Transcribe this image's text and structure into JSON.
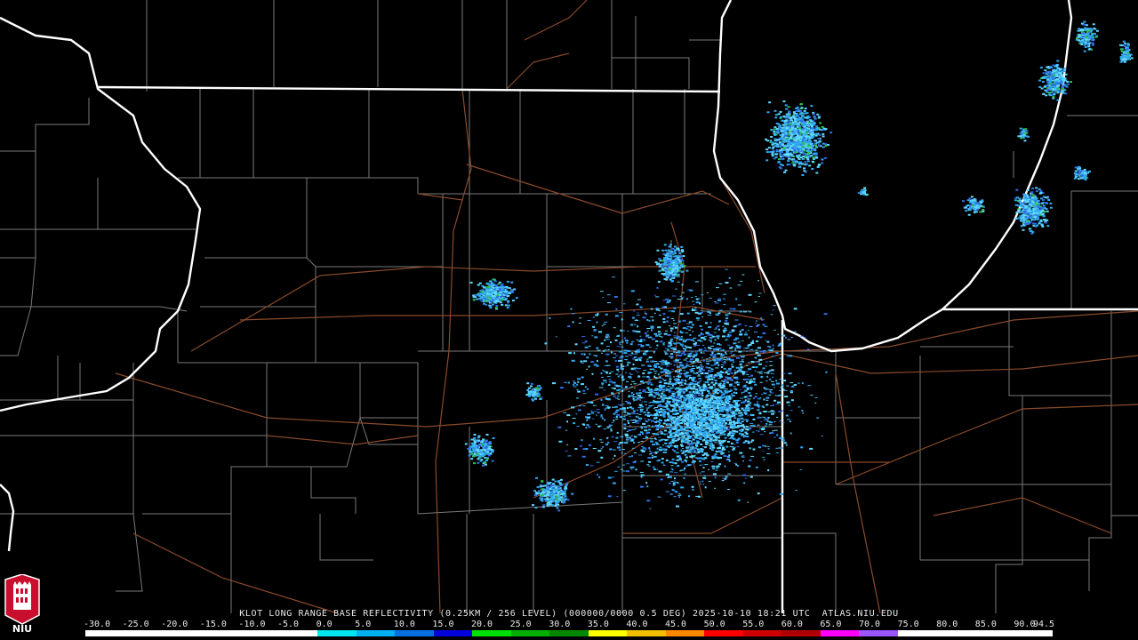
{
  "caption": "KLOT LONG RANGE BASE REFLECTIVITY (0.25KM / 256 LEVEL) (000000/0000 0.5 DEG) 2025-10-10 18:21 UTC  ATLAS.NIU.EDU",
  "logo": {
    "text": "NIU",
    "icon": "niu-tower-logo-icon"
  },
  "colorscale": {
    "labels": [
      "-30.0",
      "-25.0",
      "-20.0",
      "-15.0",
      "-10.0",
      "-5.0",
      "0.0",
      "5.0",
      "10.0",
      "15.0",
      "20.0",
      "25.0",
      "30.0",
      "35.0",
      "40.0",
      "45.0",
      "50.0",
      "55.0",
      "60.0",
      "65.0",
      "70.0",
      "75.0",
      "80.0",
      "85.0",
      "90.0",
      "94.5"
    ],
    "colors": [
      "#ffffff",
      "#ffffff",
      "#ffffff",
      "#ffffff",
      "#ffffff",
      "#ffffff",
      "#00e5ee",
      "#00b0f0",
      "#0070e0",
      "#0000d8",
      "#00e000",
      "#00b000",
      "#008800",
      "#ffff00",
      "#f0c000",
      "#ff8800",
      "#ff0000",
      "#d00000",
      "#b00000",
      "#ff00ff",
      "#9955ff",
      "#ffffff",
      "#ffffff",
      "#ffffff",
      "#ffffff"
    ]
  },
  "colors": {
    "background": "#000000",
    "state_border": "#ffffff",
    "county_border": "#7a7a7a",
    "highway": "#8a4a2a",
    "echo_light": "#5fd8ff",
    "echo_mid": "#30a8f0",
    "echo_dark": "#2f6de0",
    "echo_green": "#2dc040"
  }
}
